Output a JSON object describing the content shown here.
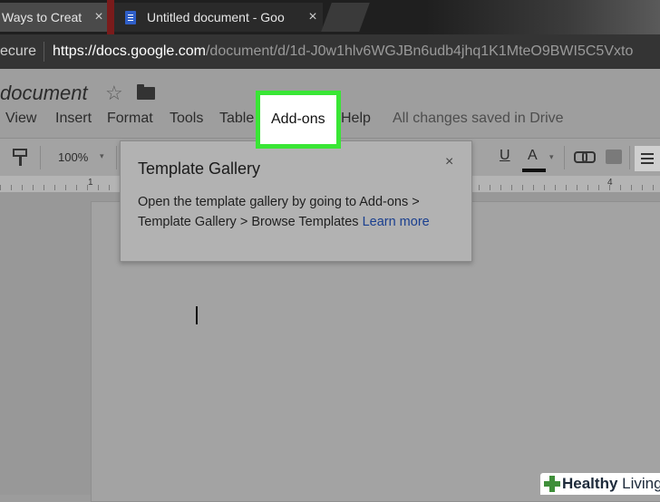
{
  "browser": {
    "tabs": [
      {
        "label": "Ways to Creat",
        "close": "×"
      },
      {
        "label": "Untitled document - Goo",
        "close": "×"
      }
    ],
    "address": {
      "secure_label": "ecure",
      "url_domain": "https://docs.google.com",
      "url_path": "/document/d/1d-J0w1hlv6WGJBn6udb4jhq1K1MteO9BWI5C5Vxto"
    }
  },
  "docs": {
    "title": "document",
    "star_glyph": "☆",
    "menu": [
      "View",
      "Insert",
      "Format",
      "Tools",
      "Table",
      "Add-ons",
      "Help"
    ],
    "save_status": "All changes saved in Drive",
    "highlight_color": "#39e635"
  },
  "toolbar": {
    "zoom": "100%",
    "underline": "U",
    "text_color": "A",
    "dropdown_glyph": "▾"
  },
  "ruler": {
    "marks": [
      "1",
      "4"
    ]
  },
  "popup": {
    "title": "Template Gallery",
    "close": "×",
    "body": "Open the template gallery by going to Add-ons > Template Gallery > Browse Templates",
    "link": "Learn more"
  },
  "watermark": {
    "brand_bold": "Healthy",
    "brand_light": " Living",
    "color": "#3f8f3a"
  }
}
